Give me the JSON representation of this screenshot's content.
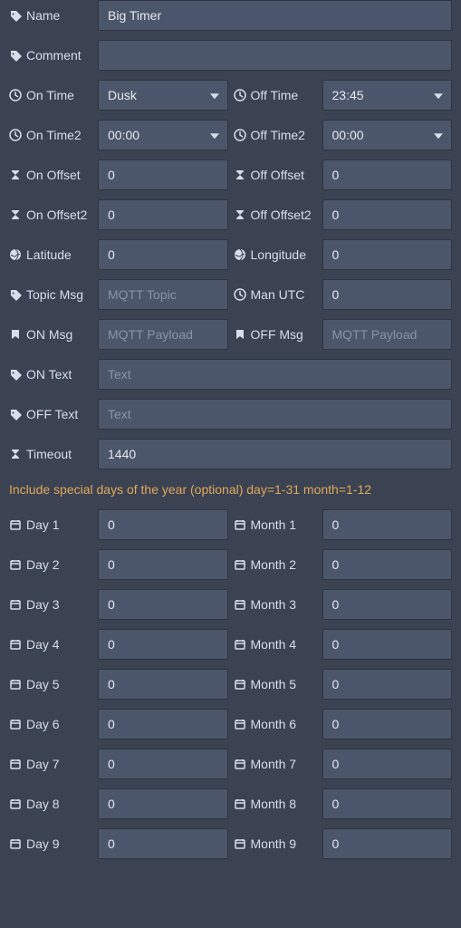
{
  "labels": {
    "name": "Name",
    "comment": "Comment",
    "onTime": "On Time",
    "offTime": "Off Time",
    "onTime2": "On Time2",
    "offTime2": "Off Time2",
    "onOffset": "On Offset",
    "offOffset": "Off Offset",
    "onOffset2": "On Offset2",
    "offOffset2": "Off Offset2",
    "latitude": "Latitude",
    "longitude": "Longitude",
    "topicMsg": "Topic Msg",
    "manUtc": "Man UTC",
    "onMsg": "ON Msg",
    "offMsg": "OFF Msg",
    "onText": "ON Text",
    "offText": "OFF Text",
    "timeout": "Timeout"
  },
  "values": {
    "name": "Big Timer",
    "comment": "",
    "onTime": "Dusk",
    "offTime": "23:45",
    "onTime2": "00:00",
    "offTime2": "00:00",
    "onOffset": "0",
    "offOffset": "0",
    "onOffset2": "0",
    "offOffset2": "0",
    "latitude": "0",
    "longitude": "0",
    "topicMsg": "",
    "manUtc": "0",
    "onMsg": "",
    "offMsg": "",
    "onText": "",
    "offText": "",
    "timeout": "1440"
  },
  "placeholders": {
    "topicMsg": "MQTT Topic",
    "onMsg": "MQTT Payload",
    "offMsg": "MQTT Payload",
    "onText": "Text",
    "offText": "Text"
  },
  "sectionNote": "Include special days of the year (optional) day=1-31 month=1-12",
  "days": [
    {
      "dayLabel": "Day 1",
      "monthLabel": "Month 1",
      "dayVal": "0",
      "monthVal": "0"
    },
    {
      "dayLabel": "Day 2",
      "monthLabel": "Month 2",
      "dayVal": "0",
      "monthVal": "0"
    },
    {
      "dayLabel": "Day 3",
      "monthLabel": "Month 3",
      "dayVal": "0",
      "monthVal": "0"
    },
    {
      "dayLabel": "Day 4",
      "monthLabel": "Month 4",
      "dayVal": "0",
      "monthVal": "0"
    },
    {
      "dayLabel": "Day 5",
      "monthLabel": "Month 5",
      "dayVal": "0",
      "monthVal": "0"
    },
    {
      "dayLabel": "Day 6",
      "monthLabel": "Month 6",
      "dayVal": "0",
      "monthVal": "0"
    },
    {
      "dayLabel": "Day 7",
      "monthLabel": "Month 7",
      "dayVal": "0",
      "monthVal": "0"
    },
    {
      "dayLabel": "Day 8",
      "monthLabel": "Month 8",
      "dayVal": "0",
      "monthVal": "0"
    },
    {
      "dayLabel": "Day 9",
      "monthLabel": "Month 9",
      "dayVal": "0",
      "monthVal": "0"
    }
  ]
}
